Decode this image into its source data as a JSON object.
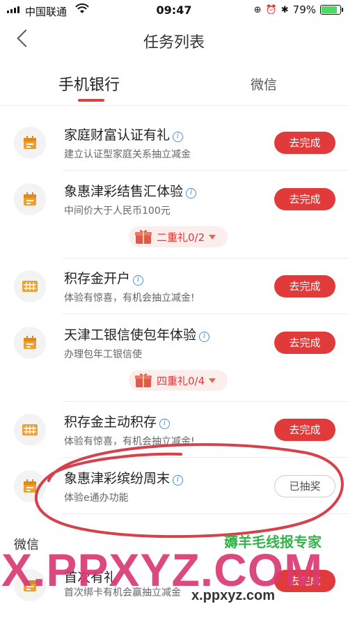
{
  "status_bar": {
    "carrier": "中国联通",
    "time": "09:47",
    "battery": "79%"
  },
  "header": {
    "title": "任务列表"
  },
  "tabs": [
    {
      "label": "手机银行"
    },
    {
      "label": "微信"
    }
  ],
  "tasks": [
    {
      "name": "家庭财富认证有礼",
      "desc": "建立认证型家庭关系抽立减金",
      "button": "去完成",
      "icon": "calendar-icon"
    },
    {
      "name": "象惠津彩结售汇体验",
      "desc": "中间价大于人民币100元",
      "button": "去完成",
      "icon": "calendar-icon"
    },
    {
      "name": "积存金开户",
      "desc": "体验有惊喜，有机会抽立减金!",
      "button": "去完成",
      "icon": "abacus-icon"
    },
    {
      "name": "天津工银信使包年体验",
      "desc": "办理包年工银信使",
      "button": "去完成",
      "icon": "calendar-icon"
    },
    {
      "name": "积存金主动积存",
      "desc": "体验有惊喜，有机会抽立减金!",
      "button": "去完成",
      "icon": "abacus-icon"
    },
    {
      "name": "象惠津彩缤纷周末",
      "desc": "体验e通办功能",
      "button": "已抽奖",
      "icon": "calendar-icon"
    },
    {
      "name": "首次有礼",
      "desc": "首次绑卡有机会赢抽立减金",
      "button": "去完成",
      "icon": "calendar-icon"
    }
  ],
  "gifts": [
    {
      "label": "二重礼0/2"
    },
    {
      "label": "四重礼0/4"
    }
  ],
  "section_wechat": "微信",
  "info_glyph": "i",
  "watermark": {
    "main": "X.PPXYZ.COM",
    "small": "x.ppxyz.com",
    "cn": "薅羊毛线报专家"
  },
  "colors": {
    "accent": "#e03a3a",
    "icon": "#f0a030",
    "info": "#4a8fd4",
    "circle": "#cf2f3a"
  }
}
